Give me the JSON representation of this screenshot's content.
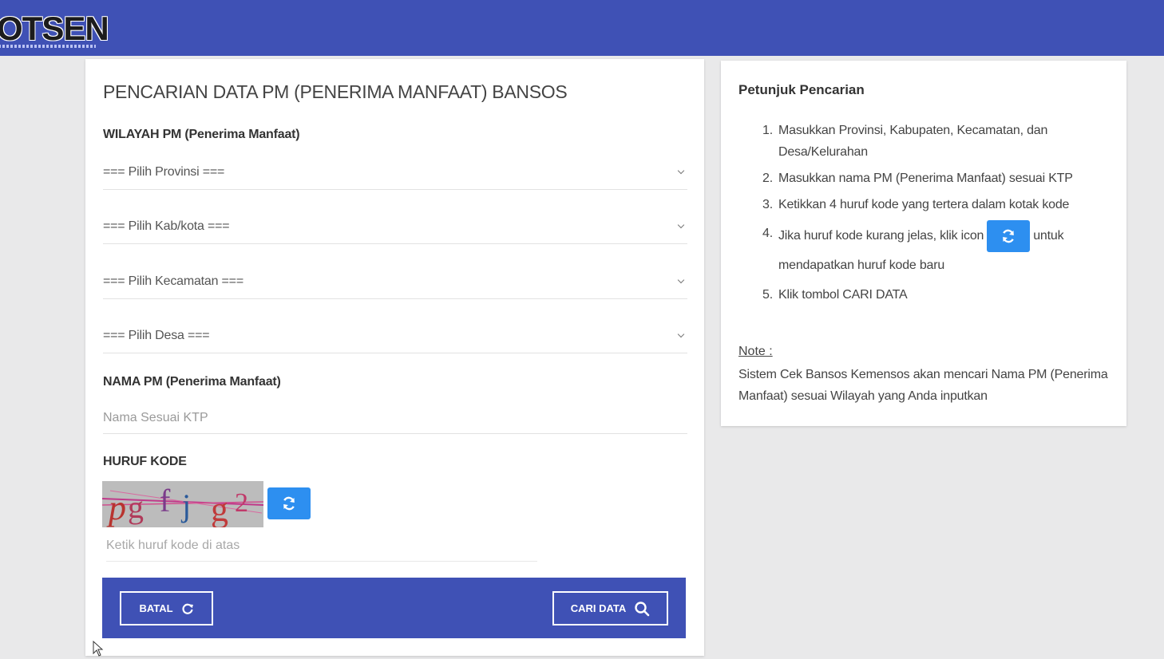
{
  "header": {
    "logo_text": "OTSEN",
    "bg_color": "#3f51b5"
  },
  "form": {
    "title": "PENCARIAN DATA PM (PENERIMA MANFAAT) BANSOS",
    "wilayah_label": "WILAYAH PM (Penerima Manfaat)",
    "selects": {
      "provinsi": "=== Pilih Provinsi ===",
      "kabkota": "=== Pilih Kab/kota ===",
      "kecamatan": "=== Pilih Kecamatan ===",
      "desa": "=== Pilih Desa ==="
    },
    "nama_label": "NAMA PM (Penerima Manfaat)",
    "nama_placeholder": "Nama Sesuai KTP",
    "nama_value": "",
    "kode_label": "HURUF KODE",
    "captcha_text": "pg f j g2",
    "kode_placeholder": "Ketik huruf kode di atas",
    "kode_value": "",
    "batal_label": "BATAL",
    "cari_label": "CARI DATA",
    "accent_color": "#2d8ff0"
  },
  "help": {
    "title": "Petunjuk Pencarian",
    "items": [
      {
        "num": "1.",
        "text": "Masukkan Provinsi, Kabupaten, Kecamatan, dan Desa/Kelurahan"
      },
      {
        "num": "2.",
        "text": "Masukkan nama PM (Penerima Manfaat) sesuai KTP"
      },
      {
        "num": "3.",
        "text": "Ketikkan 4 huruf kode yang tertera dalam kotak kode"
      },
      {
        "num": "4.",
        "text_before": "Jika huruf kode kurang jelas, klik icon",
        "text_after": "untuk mendapatkan huruf kode baru"
      },
      {
        "num": "5.",
        "text": "Klik tombol CARI DATA"
      }
    ],
    "note_label": "Note :",
    "note_text": "Sistem Cek Bansos Kemensos akan mencari Nama PM (Penerima Manfaat) sesuai Wilayah yang Anda inputkan"
  }
}
